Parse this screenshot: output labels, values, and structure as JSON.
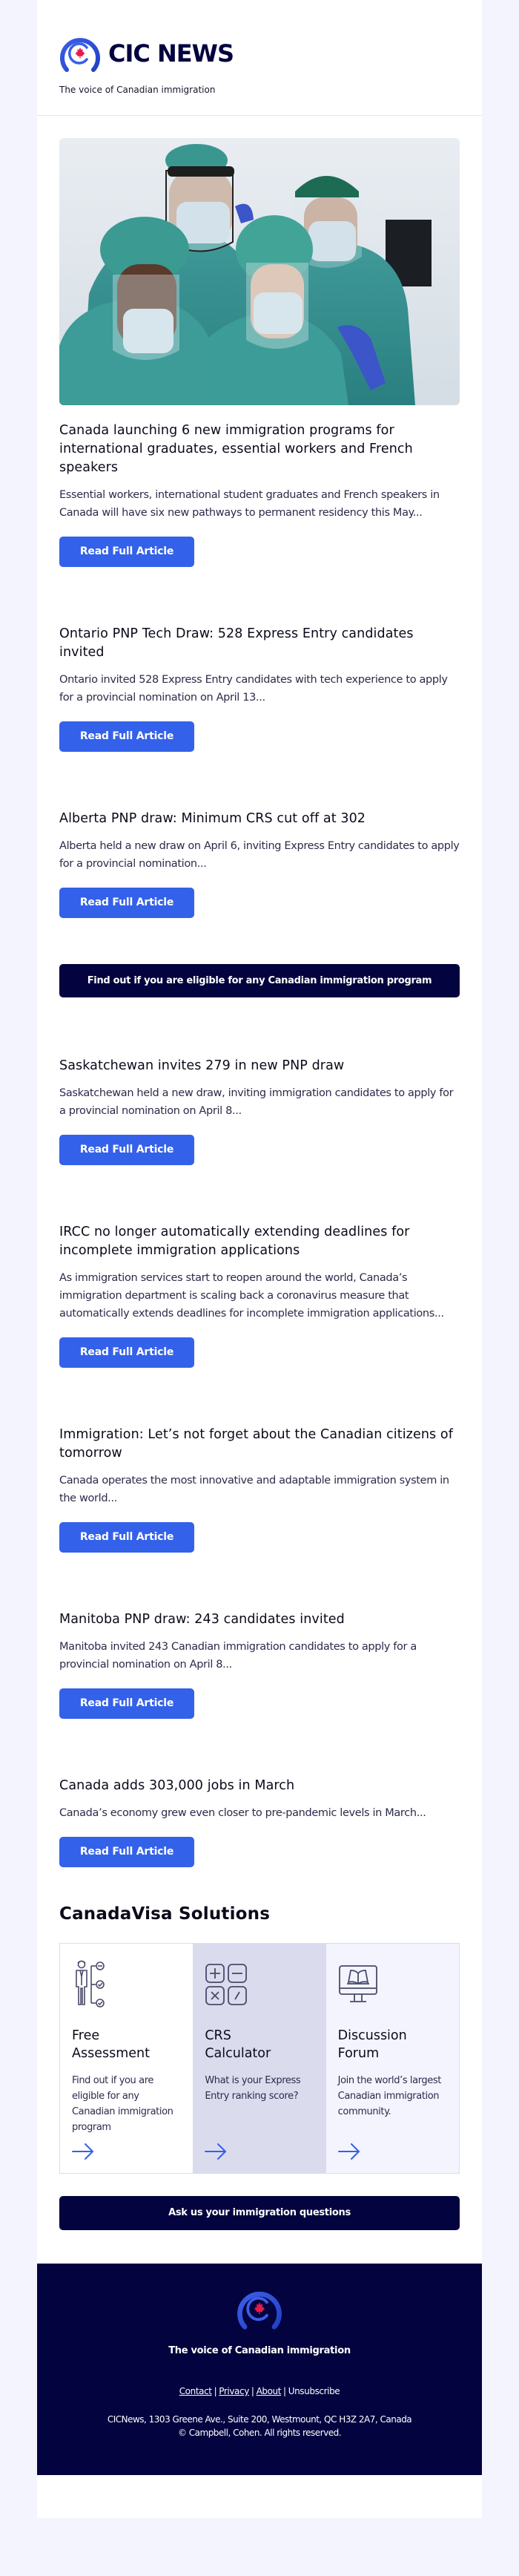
{
  "header": {
    "brand_name": "CIC NEWS",
    "tagline": "The voice of Canadian immigration"
  },
  "colors": {
    "accent": "#3461ea",
    "navy": "#02033f",
    "maple_red": "#e6194b",
    "page_bg": "#f3f4fd"
  },
  "hero_image": {
    "alt": "Healthcare workers in protective gear, face shields and masks"
  },
  "articles": [
    {
      "title": "Canada launching 6 new immigration programs for international graduates, essential workers and French speakers",
      "description": "Essential workers, international student graduates and French speakers in Canada will have six new pathways to permanent residency this May...",
      "button": "Read Full Article"
    },
    {
      "title": "Ontario PNP Tech Draw: 528 Express Entry candidates invited",
      "description": "Ontario invited 528 Express Entry candidates with tech experience to apply for a provincial nomination on April 13...",
      "button": "Read Full Article"
    },
    {
      "title": "Alberta PNP draw: Minimum CRS cut off at 302",
      "description": "Alberta held a new draw on April 6, inviting Express Entry candidates to apply for a provincial nomination...",
      "button": "Read Full Article"
    },
    {
      "title": "Saskatchewan invites 279 in new PNP draw",
      "description": "Saskatchewan held a new draw, inviting immigration candidates to apply for a provincial nomination on April 8...",
      "button": "Read Full Article"
    },
    {
      "title": "IRCC no longer automatically extending deadlines for incomplete immigration applications",
      "description": "As immigration services start to reopen around the world, Canada’s immigration department is scaling back a coronavirus measure that automatically extends deadlines for incomplete immigration applications...",
      "button": "Read Full Article"
    },
    {
      "title": "Immigration: Let’s not forget about the Canadian citizens of tomorrow",
      "description": "Canada operates the most innovative and adaptable immigration system in the world...",
      "button": "Read Full Article"
    },
    {
      "title": "Manitoba PNP draw: 243 candidates invited",
      "description": "Manitoba invited 243 Canadian immigration candidates to apply for a provincial nomination on April 8...",
      "button": "Read Full Article"
    },
    {
      "title": "Canada adds 303,000 jobs in March",
      "description": "Canada’s economy grew even closer to pre-pandemic levels in March...",
      "button": "Read Full Article"
    }
  ],
  "eligibility_cta": "Find out if you are eligible for any Canadian immigration program",
  "solutions": {
    "title": "CanadaVisa Solutions",
    "cards": [
      {
        "icon": "assessment-checklist-icon",
        "title_line1": "Free",
        "title_line2": "Assessment",
        "description": "Find out if you are eligible for any Canadian immigration program"
      },
      {
        "icon": "calculator-icon",
        "title_line1": "CRS",
        "title_line2": "Calculator",
        "description": "What is your Express Entry ranking score?"
      },
      {
        "icon": "monitor-book-icon",
        "title_line1": "Discussion",
        "title_line2": "Forum",
        "description": "Join the world’s largest Canadian immigration community."
      }
    ]
  },
  "ask_cta": "Ask us your immigration questions",
  "footer": {
    "tagline": "The voice of Canadian immigration",
    "links": [
      "Contact",
      "Privacy",
      "About",
      "Unsubscribe"
    ],
    "separator": "|",
    "address": "CICNews, 1303 Greene Ave., Suite 200, Westmount, QC H3Z 2A7, Canada",
    "copyright": "© Campbell, Cohen. All rights reserved."
  }
}
